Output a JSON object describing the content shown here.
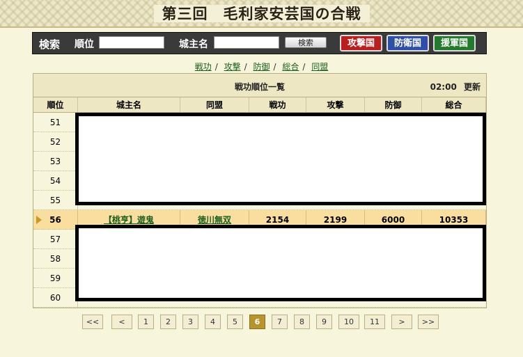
{
  "page": {
    "title": "第三回　毛利家安芸国の合戦"
  },
  "search": {
    "label": "検索",
    "rank_label": "順位",
    "lord_label": "城主名",
    "rank_value": "",
    "lord_value": "",
    "button_label": "検索"
  },
  "nations": [
    {
      "label": "攻撃国",
      "color": "#b81f1f"
    },
    {
      "label": "防衛国",
      "color": "#2f4ea8"
    },
    {
      "label": "援軍国",
      "color": "#237a2d"
    }
  ],
  "subnav": [
    "戦功",
    "攻撃",
    "防御",
    "総合",
    "同盟"
  ],
  "ranking": {
    "caption": "戦功順位一覧",
    "time": "02:00",
    "refresh_label": "更新",
    "headers": [
      "順位",
      "城主名",
      "同盟",
      "戦功",
      "攻撃",
      "防御",
      "総合"
    ],
    "ranks_before": [
      "51",
      "52",
      "53",
      "54",
      "55"
    ],
    "highlight": {
      "rank": "56",
      "name": "【桃亨】遊鬼",
      "alliance": "徳川無双",
      "merit": "2154",
      "attack": "2199",
      "defense": "6000",
      "total": "10353"
    },
    "ranks_after": [
      "57",
      "58",
      "59",
      "60"
    ]
  },
  "pagination": {
    "first": "<<",
    "prev": "<",
    "pages": [
      "1",
      "2",
      "3",
      "4",
      "5",
      "6",
      "7",
      "8",
      "9",
      "10",
      "11"
    ],
    "current": "6",
    "next": ">",
    "last": ">>"
  }
}
